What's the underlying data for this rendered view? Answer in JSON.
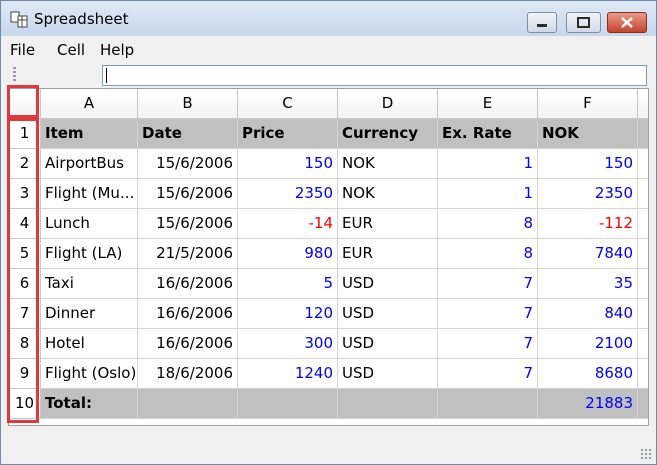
{
  "window": {
    "title": "Spreadsheet"
  },
  "menu": [
    "File",
    "Cell",
    "Help"
  ],
  "formula_bar": {
    "value": ""
  },
  "columns": [
    "A",
    "B",
    "C",
    "D",
    "E",
    "F"
  ],
  "rows": [
    {
      "num": "1",
      "cells": [
        "Item",
        "Date",
        "Price",
        "Currency",
        "Ex. Rate",
        "NOK"
      ],
      "style": "header"
    },
    {
      "num": "2",
      "cells": [
        "AirportBus",
        "15/6/2006",
        "150",
        "NOK",
        "1",
        "150"
      ]
    },
    {
      "num": "3",
      "cells": [
        "Flight (Mu...",
        "15/6/2006",
        "2350",
        "NOK",
        "1",
        "2350"
      ]
    },
    {
      "num": "4",
      "cells": [
        "Lunch",
        "15/6/2006",
        "-14",
        "EUR",
        "8",
        "-112"
      ]
    },
    {
      "num": "5",
      "cells": [
        "Flight (LA)",
        "21/5/2006",
        "980",
        "EUR",
        "8",
        "7840"
      ]
    },
    {
      "num": "6",
      "cells": [
        "Taxi",
        "16/6/2006",
        "5",
        "USD",
        "7",
        "35"
      ]
    },
    {
      "num": "7",
      "cells": [
        "Dinner",
        "16/6/2006",
        "120",
        "USD",
        "7",
        "840"
      ]
    },
    {
      "num": "8",
      "cells": [
        "Hotel",
        "16/6/2006",
        "300",
        "USD",
        "7",
        "2100"
      ]
    },
    {
      "num": "9",
      "cells": [
        "Flight (Oslo)",
        "18/6/2006",
        "1240",
        "USD",
        "7",
        "8680"
      ]
    },
    {
      "num": "10",
      "cells": [
        "Total:",
        "",
        "",
        "",
        "",
        "21883"
      ],
      "style": "total"
    }
  ],
  "colors": {
    "number": "#0000ff",
    "negative": "#ff0000",
    "highlight": "#e0383c",
    "header_row_bg": "#c0c0c0"
  },
  "icons": {
    "app": "spreadsheet-app-icon",
    "minimize": "minimize-icon",
    "maximize": "maximize-icon",
    "close": "close-icon"
  }
}
